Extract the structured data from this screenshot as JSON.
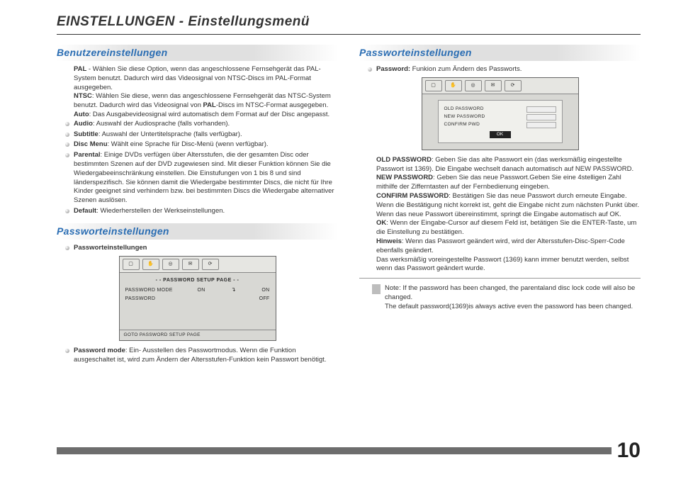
{
  "page": {
    "title": "EINSTELLUNGEN - Einstellungsmenü",
    "number": "10"
  },
  "left": {
    "sec1": {
      "heading": "Benutzereinstellungen",
      "pal_term": "PAL",
      "pal_text": " - Wählen Sie diese Option, wenn das angeschlossene Fernsehgerät das PAL-System benutzt. Dadurch wird das Videosignal von NTSC-Discs im PAL-Format ausgegeben.",
      "ntsc_term": "NTSC",
      "ntsc_text": ": Wählen Sie diese, wenn das angeschlossene Fernsehgerät das NTSC-System benutzt. Dadurch wird das Videosignal von ",
      "pal2_term": "PAL",
      "pal2_text": "-Discs im NTSC-Format ausgegeben.",
      "auto_term": "Auto",
      "auto_text": ": Das Ausgabevideosignal wird automatisch dem Format auf der Disc angepasst.",
      "b1_term": "Audio",
      "b1_text": ": Auswahl der Audiosprache (falls vorhanden).",
      "b2_term": "Subtitle",
      "b2_text": ": Auswahl der Untertitelsprache (falls verfügbar).",
      "b3_term": "Disc Menu",
      "b3_text": ": Wählt eine Sprache für Disc-Menü (wenn verfügbar).",
      "b4_term": "Parental",
      "b4_text": ": Einige DVDs verfügen über Altersstufen, die der gesamten Disc oder bestimmten Szenen auf der DVD zugewiesen sind. Mit dieser Funktion können Sie die Wiedergabeeinschränkung einstellen. Die Einstufungen von 1 bis 8 und sind länderspezifisch. Sie können damit die Wiedergabe bestimmter Discs, die nicht für Ihre Kinder geeignet sind verhindern bzw. bei bestimmten Discs die Wiedergabe alternativer Szenen auslösen.",
      "b5_term": "Default",
      "b5_text": ": Wiederherstellen der Werkseinstellungen."
    },
    "sec2": {
      "heading": "Passworteinstellungen",
      "bullet_label": "Passworteinstellungen",
      "osd": {
        "title": "- -   PASSWORD SETUP PAGE   - -",
        "row1_l": "PASSWORD MODE",
        "row1_m": "ON",
        "row1_r": "ON",
        "row2_l": "PASSWORD",
        "row2_r": "OFF",
        "footer": "GOTO PASSWORD SETUP PAGE"
      },
      "mode_term": "Password mode",
      "mode_text": ": Ein- Ausstellen des Passwortmodus. Wenn die Funktion ausgeschaltet ist, wird zum Ändern der Altersstufen-Funktion kein Passwort benötigt."
    }
  },
  "right": {
    "heading": "Passworteinstellungen",
    "pw_term": "Password:",
    "pw_text": " Funkion zum Ändern des Passworts.",
    "osd": {
      "r1": "OLD  PASSWORD",
      "r2": "NEW PASSWORD",
      "r3": "CONFIRM PWD",
      "ok": "OK"
    },
    "old_term": "OLD PASSWORD",
    "old_text": ": Geben Sie das alte Passwort ein (das werksmäßig eingestellte Passwort ist 1369). Die Eingabe wechselt danach automatisch auf NEW PASSWORD.",
    "new_term": "NEW PASSWORD",
    "new_text": ": Geben Sie das neue Passwort.Geben Sie eine 4stelligen Zahl mithilfe der Zifferntasten auf der Fernbedienung eingeben.",
    "conf_term": "CONFIRM PASSWORD",
    "conf_text": ": Bestätigen Sie das neue Passwort durch erneute Eingabe. Wenn die Bestätigung nicht korrekt ist, geht die Eingabe nicht zum nächsten Punkt über. Wenn das neue Passwort übereinstimmt, springt die Eingabe automatisch auf OK.",
    "ok_term": "OK",
    "ok_text": ": Wenn der Eingabe-Cursor auf diesem Feld ist, betätigen Sie die ENTER-Taste, um die Einstellung zu bestätigen.",
    "hint_term": "Hinweis",
    "hint_text": ": Wenn das Passwort geändert wird, wird der Altersstufen-Disc-Sperr-Code ebenfalls geändert.",
    "tail": "Das werksmäßig voreingestellte Passwort (1369) kann immer benutzt werden, selbst wenn das Passwort geändert wurde.",
    "note1": "Note: If the password has been changed, the parentaland disc lock code will also be changed.",
    "note2": "The default password(1369)is always active even the password has been changed."
  }
}
